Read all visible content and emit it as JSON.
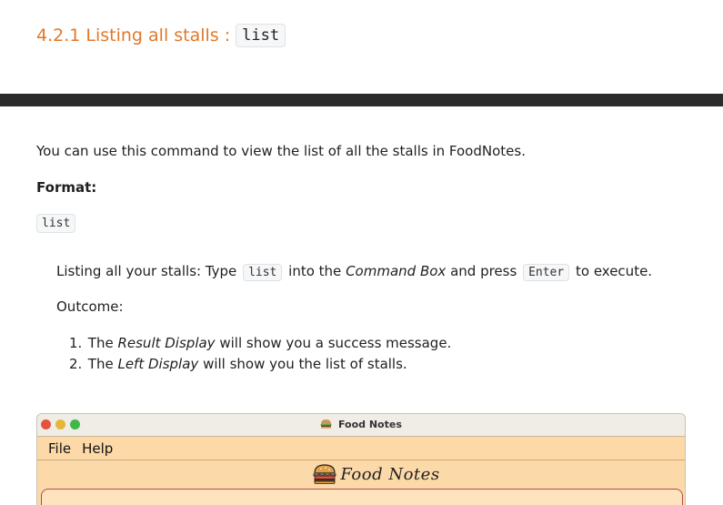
{
  "section": {
    "heading_text": "4.2.1 Listing all stalls :",
    "heading_code": "list"
  },
  "intro": "You can use this command to view the list of all the stalls in FoodNotes.",
  "format": {
    "label": "Format:",
    "code": "list"
  },
  "tip": {
    "prefix": "Listing all your stalls: Type",
    "code1": "list",
    "middle1": "into the",
    "emphasis": "Command Box",
    "middle2": "and press",
    "code2": "Enter",
    "suffix": "to execute."
  },
  "outcome": {
    "label": "Outcome:",
    "steps": [
      {
        "num": "1.",
        "pre": "The",
        "em": "Result Display",
        "post": "will show you a success message."
      },
      {
        "num": "2.",
        "pre": "The",
        "em": "Left Display",
        "post": "will show you the list of stalls."
      }
    ]
  },
  "app_window": {
    "title": "Food Notes",
    "menu": [
      "File",
      "Help"
    ],
    "logo_text": "Food Notes"
  },
  "colors": {
    "heading": "#e2772a",
    "divider": "#2b2b2b",
    "app_background": "#fcd9a8"
  }
}
